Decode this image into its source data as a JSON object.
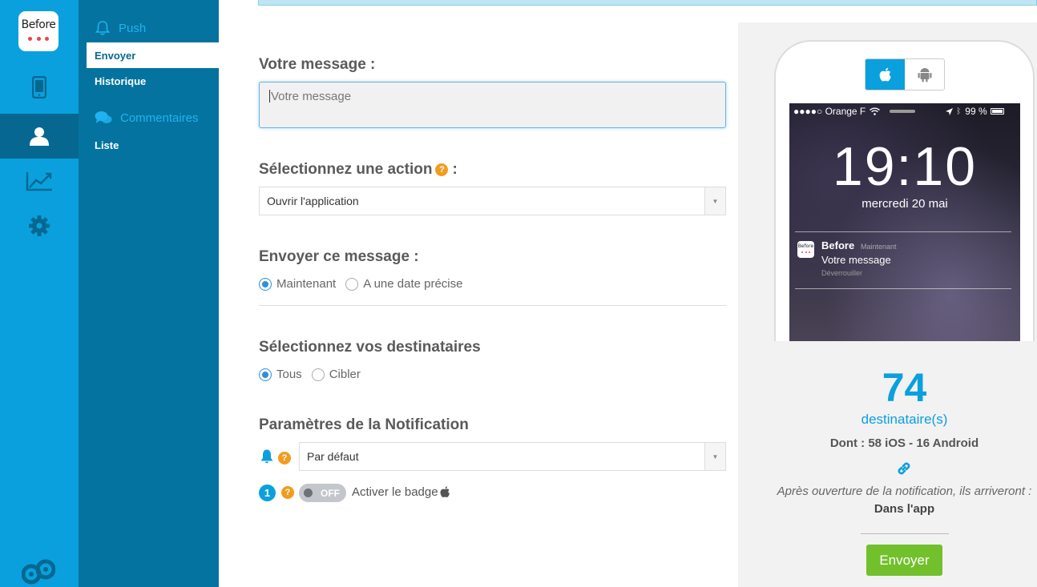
{
  "app": {
    "logo_text": "Before"
  },
  "colors": {
    "brand": "#0aa0dd",
    "brand_dark": "#066891",
    "submenu_bg": "#04739f",
    "accent_orange": "#f29c1f",
    "send_green": "#72c02c"
  },
  "rail": {
    "items": [
      {
        "icon": "mobile-icon"
      },
      {
        "icon": "user-icon",
        "active": true
      },
      {
        "icon": "chart-icon"
      },
      {
        "icon": "gear-icon"
      }
    ],
    "bottom_icon": "owl-icon"
  },
  "submenu": {
    "push_heading": "Push",
    "push_items": [
      "Envoyer",
      "Historique"
    ],
    "comments_heading": "Commentaires",
    "comments_items": [
      "Liste"
    ]
  },
  "form": {
    "message_label": "Votre message :",
    "message_placeholder": "Votre message",
    "action_label": "Sélectionnez une action",
    "action_colon": ":",
    "action_value": "Ouvrir l'application",
    "send_when_label": "Envoyer ce message :",
    "send_when_options": [
      "Maintenant",
      "A une date précise"
    ],
    "send_when_selected": "Maintenant",
    "recipients_label": "Sélectionnez vos destinataires",
    "recipients_options": [
      "Tous",
      "Cibler"
    ],
    "recipients_selected": "Tous",
    "notif_params_label": "Paramètres de la Notification",
    "sound_value": "Par défaut",
    "badge_number": "1",
    "badge_toggle": "OFF",
    "badge_label": "Activer le badge"
  },
  "preview": {
    "carrier": "●●●●○ Orange F",
    "battery": "99 %",
    "time": "19:10",
    "date": "mercredi 20 mai",
    "notif_app": "Before",
    "notif_time": "Maintenant",
    "notif_message": "Votre message",
    "notif_sub": "Déverrouiller"
  },
  "summary": {
    "count": "74",
    "count_label": "destinataire(s)",
    "split": "Dont : 58 iOS - 16 Android",
    "after_open": "Après ouverture de la notification, ils arriveront :",
    "destination": "Dans l'app",
    "send_button": "Envoyer"
  }
}
